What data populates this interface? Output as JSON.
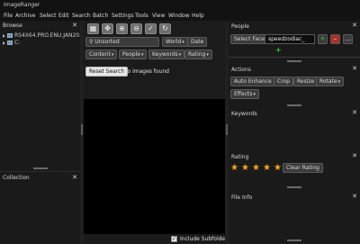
{
  "window": {
    "title": "ImageRanger"
  },
  "menu": [
    "File",
    "Archive",
    "Select",
    "Edit",
    "Search",
    "Batch",
    "Settings",
    "Tools",
    "View",
    "Window",
    "Help"
  ],
  "browse": {
    "title": "Browse",
    "tree": [
      {
        "label": "RS4X64.PRO.ENU.JAN20..."
      },
      {
        "label": "C:"
      }
    ]
  },
  "collection": {
    "title": "Collection"
  },
  "center": {
    "toolbar_icons": [
      "grid-icon",
      "fit-icon",
      "zoom-in-icon",
      "zoom-out-icon",
      "check-icon",
      "refresh-icon"
    ],
    "search_placeholder": "Unsorted",
    "filters_row1": {
      "world": "World",
      "date": "Date"
    },
    "filters_row2": {
      "content": "Content",
      "people": "People",
      "keywords": "Keywords",
      "rating": "Rating"
    },
    "reset_label": "Reset Search",
    "status": "No images found",
    "include_subfolders": "Include Subfolders",
    "include_subfolders_checked": true
  },
  "people": {
    "title": "People",
    "select_face": "Select Face",
    "face_name": "speedzodiac_"
  },
  "actions": {
    "title": "Actions",
    "buttons": [
      "Auto Enhance",
      "Crop",
      "Resize",
      "Rotate",
      "Effects"
    ]
  },
  "keywords": {
    "title": "Keywords"
  },
  "rating": {
    "title": "Rating",
    "stars": 5,
    "clear_label": "Clear Rating"
  },
  "fileinfo": {
    "title": "File Info"
  },
  "colors": {
    "accent_star": "#f5a623",
    "add_green": "#39c439",
    "add_button_red": "#a7322a"
  }
}
